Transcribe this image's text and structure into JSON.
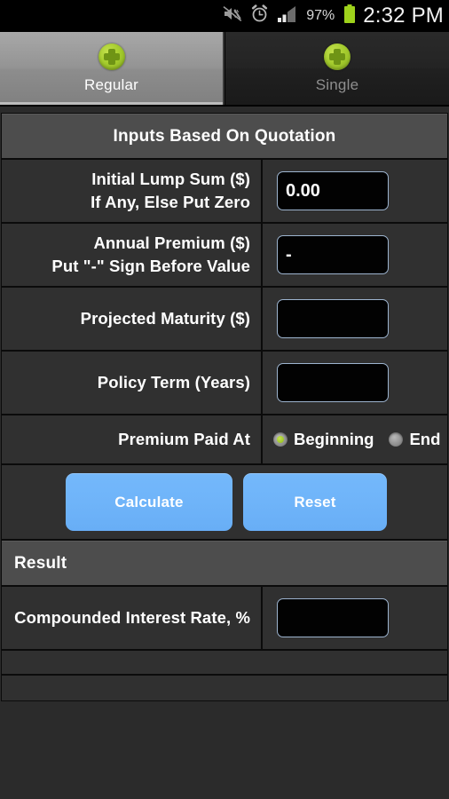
{
  "statusbar": {
    "icons": [
      "mute-vibrate-icon",
      "alarm-clock-icon",
      "signal-bars-icon",
      "battery-icon"
    ],
    "battery_percent": "97%",
    "time": "2:32 PM"
  },
  "tabs": [
    {
      "label": "Regular",
      "icon": "green-plus-circle-icon",
      "selected": true
    },
    {
      "label": "Single",
      "icon": "green-plus-circle-icon",
      "selected": false
    }
  ],
  "sections": {
    "inputs_header": "Inputs Based On Quotation",
    "result_header": "Result"
  },
  "fields": {
    "lump_sum": {
      "label_line1": "Initial Lump Sum ($)",
      "label_line2": "If Any, Else Put Zero",
      "value": "0.00"
    },
    "premium": {
      "label_line1": "Annual Premium ($)",
      "label_line2": "Put \"-\" Sign Before Value",
      "value": "-"
    },
    "maturity": {
      "label_line1": "Projected Maturity ($)",
      "label_line2": "",
      "value": ""
    },
    "term": {
      "label_line1": "Policy Term (Years)",
      "label_line2": "",
      "value": ""
    },
    "paid_at": {
      "label_line1": "Premium Paid At",
      "label_line2": "",
      "options": [
        {
          "label": "Beginning",
          "selected": true
        },
        {
          "label": "End",
          "selected": false
        }
      ]
    },
    "rate": {
      "label_line1": "Compounded Interest Rate, %",
      "label_line2": "",
      "value": ""
    }
  },
  "buttons": {
    "calculate": "Calculate",
    "reset": "Reset"
  },
  "colors": {
    "accent_button": "#6fb4f9",
    "radio_selected": "#9fc72a",
    "input_border": "#9db4cf",
    "header_bar": "#4d4d4d",
    "row_bg": "#303030",
    "page_bg": "#2b2b2b"
  }
}
